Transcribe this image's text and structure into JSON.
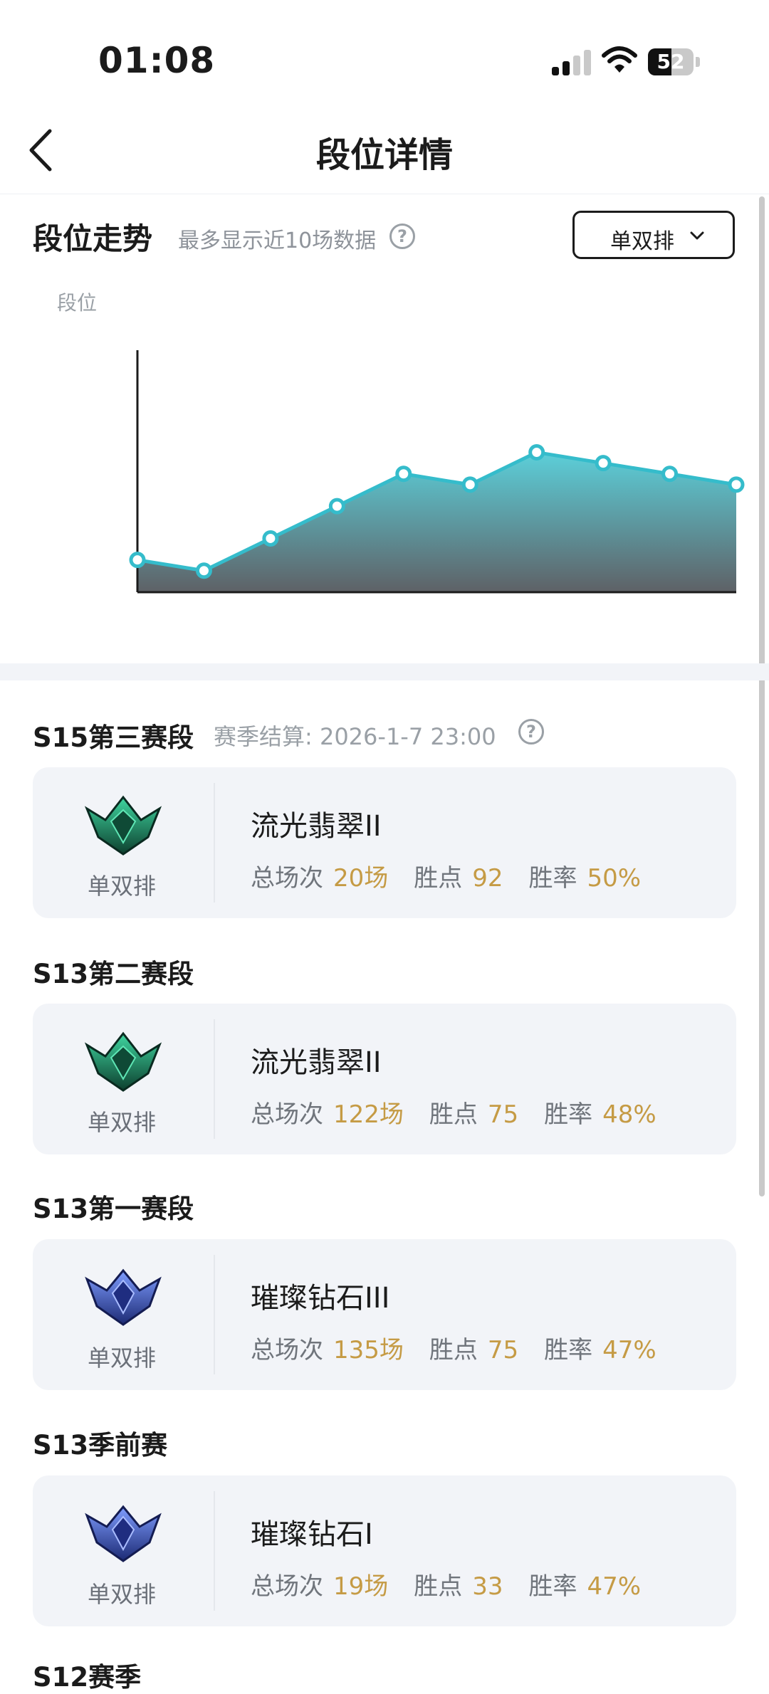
{
  "status_bar": {
    "time": "01:08",
    "battery": "52",
    "battery_level": 0.52
  },
  "nav": {
    "title": "段位详情"
  },
  "trend": {
    "title": "段位走势",
    "hint": "最多显示近10场数据",
    "queue_select": "单双排",
    "y_label": "段位"
  },
  "chart_data": {
    "type": "area",
    "ylabel": "段位",
    "x": [
      1,
      2,
      3,
      4,
      5,
      6,
      7,
      8,
      9,
      10
    ],
    "values": [
      11.5,
      10.5,
      13.5,
      16.5,
      19.5,
      18.5,
      21.5,
      20.5,
      19.5,
      18.5
    ],
    "ylim": [
      8.5,
      31
    ],
    "colors": {
      "line": "#35bccb",
      "fill_top": "#5ccfd9",
      "fill_bottom": "#5e6166"
    }
  },
  "seasons": [
    {
      "title": "S15第三赛段",
      "settle": "赛季结算: 2026-1-7 23:00",
      "queue": "单双排",
      "rank": "流光翡翠II",
      "emblem": "emerald",
      "total_label": "总场次",
      "total": "20场",
      "lp_label": "胜点",
      "lp": "92",
      "wr_label": "胜率",
      "wr": "50%"
    },
    {
      "title": "S13第二赛段",
      "queue": "单双排",
      "rank": "流光翡翠II",
      "emblem": "emerald",
      "total_label": "总场次",
      "total": "122场",
      "lp_label": "胜点",
      "lp": "75",
      "wr_label": "胜率",
      "wr": "48%"
    },
    {
      "title": "S13第一赛段",
      "queue": "单双排",
      "rank": "璀璨钻石III",
      "emblem": "diamond",
      "total_label": "总场次",
      "total": "135场",
      "lp_label": "胜点",
      "lp": "75",
      "wr_label": "胜率",
      "wr": "47%"
    },
    {
      "title": "S13季前赛",
      "queue": "单双排",
      "rank": "璀璨钻石I",
      "emblem": "diamond",
      "total_label": "总场次",
      "total": "19场",
      "lp_label": "胜点",
      "lp": "33",
      "wr_label": "胜率",
      "wr": "47%"
    }
  ],
  "next_season_title": "S12赛季"
}
